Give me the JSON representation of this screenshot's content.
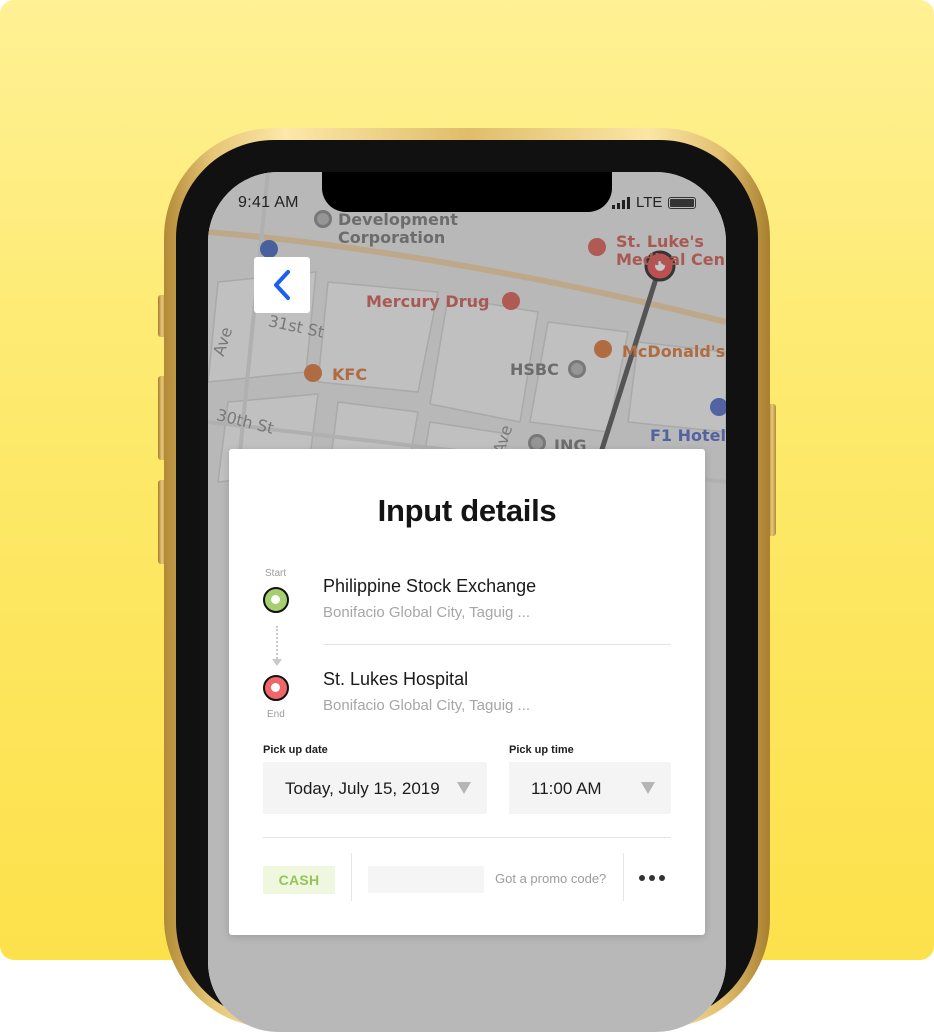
{
  "status_bar": {
    "time": "9:41 AM",
    "network": "LTE"
  },
  "map": {
    "labels": {
      "development": "Development",
      "corporation": "Corporation",
      "st_lukes_1": "St. Luke's",
      "st_lukes_2": "Medical Cen",
      "mercury_drug": "Mercury Drug",
      "street_31st": "31st St",
      "mcdonalds": "McDonald's",
      "hsbc": "HSBC",
      "kfc": "KFC",
      "street_30th": "30th St",
      "ave_left": "Ave",
      "ave_mid": "Ave",
      "ing": "ING",
      "f1_hotel": "F1 Hotel"
    }
  },
  "card": {
    "title": "Input details",
    "start_label": "Start",
    "end_label": "End",
    "start": {
      "name": "Philippine Stock Exchange",
      "address": "Bonifacio Global City, Taguig ..."
    },
    "end": {
      "name": "St. Lukes Hospital",
      "address": "Bonifacio Global City, Taguig ..."
    },
    "pickup_date_label": "Pick up date",
    "pickup_date_value": "Today, July 15, 2019",
    "pickup_time_label": "Pick up time",
    "pickup_time_value": "11:00 AM",
    "payment_label": "CASH",
    "promo_text": "Got a promo code?"
  },
  "colors": {
    "start_node": "#a6cf70",
    "end_node": "#f0676a",
    "back_arrow": "#1a5ff2"
  }
}
